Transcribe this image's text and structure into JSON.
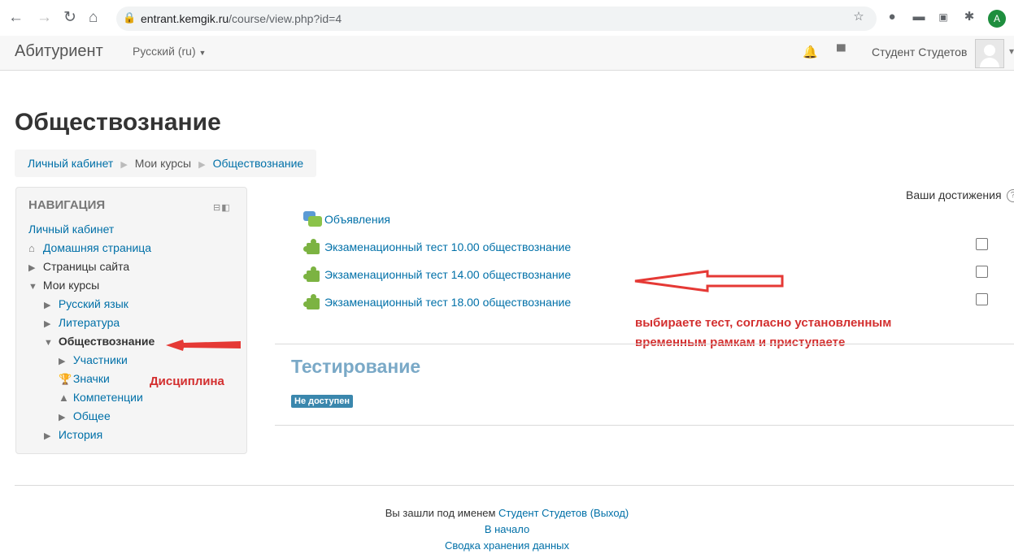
{
  "browser": {
    "url_domain": "entrant.kemgik.ru",
    "url_path": "/course/view.php?id=4",
    "profile_initial": "A"
  },
  "navbar": {
    "brand": "Абитуриент",
    "language": "Русский (ru)",
    "username": "Студент Студетов"
  },
  "page": {
    "title": "Обществознание"
  },
  "breadcrumb": [
    "Личный кабинет",
    "Мои курсы",
    "Обществознание"
  ],
  "navigation": {
    "title": "НАВИГАЦИЯ",
    "items": [
      {
        "label": "Личный кабинет"
      },
      {
        "label": "Домашняя страница"
      },
      {
        "label": "Страницы сайта"
      },
      {
        "label": "Мои курсы"
      },
      {
        "label": "Русский язык"
      },
      {
        "label": "Литература"
      },
      {
        "label": "Обществознание"
      },
      {
        "label": "Участники"
      },
      {
        "label": "Значки"
      },
      {
        "label": "Компетенции"
      },
      {
        "label": "Общее"
      },
      {
        "label": "История"
      }
    ]
  },
  "content": {
    "achievements_label": "Ваши достижения",
    "activities": [
      {
        "label": "Объявления",
        "type": "forum"
      },
      {
        "label": "Экзаменационный тест 10.00 обществознание",
        "type": "quiz"
      },
      {
        "label": "Экзаменационный тест 14.00 обществознание",
        "type": "quiz"
      },
      {
        "label": "Экзаменационный тест 18.00 обществознание",
        "type": "quiz"
      }
    ],
    "section_title": "Тестирование",
    "section_badge": "Не доступен"
  },
  "annotations": {
    "discipline": "Дисциплина",
    "instruction_line1": "выбираете тест, согласно установленным",
    "instruction_line2": "временным рамкам и приступаете",
    "arrow_color": "#e53935"
  },
  "footer": {
    "logged_in_prefix": "Вы зашли под именем",
    "user_link": "Студент Студетов",
    "logout_link": "(Выход)",
    "home_link": "В начало",
    "data_link": "Сводка хранения данных"
  }
}
